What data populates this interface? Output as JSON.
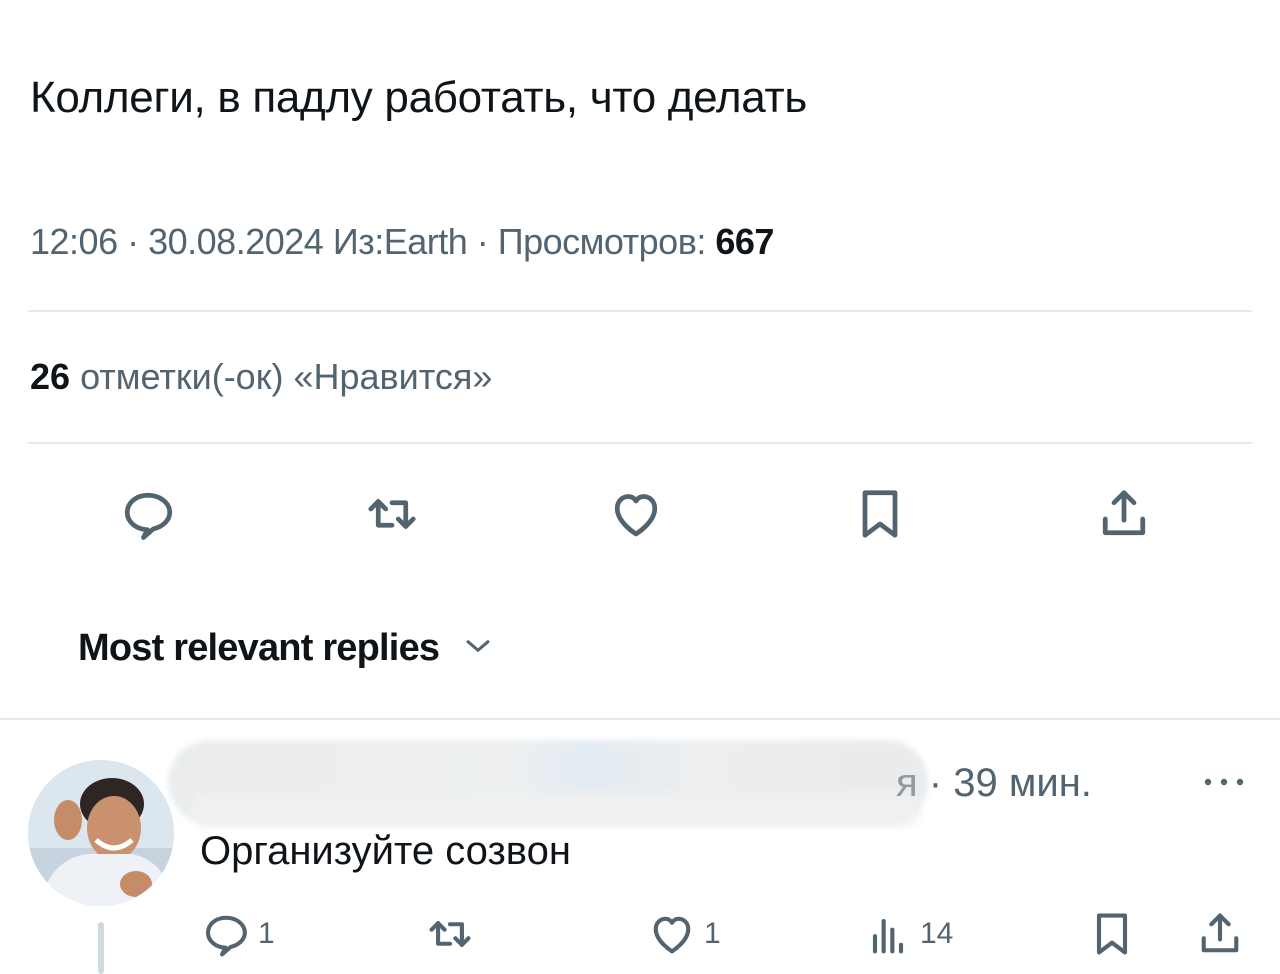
{
  "tweet": {
    "text": "Коллеги, в падлу работать, что делать",
    "time": "12:06",
    "date": "30.08.2024",
    "location": "Из:Earth",
    "views_label": "Просмотров:",
    "views_count": "667",
    "likes_count": "26",
    "likes_label": "отметки(-ок) «Нравится»"
  },
  "actions": [
    {
      "name": "reply",
      "icon": "reply-icon"
    },
    {
      "name": "retweet",
      "icon": "retweet-icon"
    },
    {
      "name": "like",
      "icon": "heart-icon"
    },
    {
      "name": "bookmark",
      "icon": "bookmark-icon"
    },
    {
      "name": "share",
      "icon": "share-icon"
    }
  ],
  "replies_section": {
    "sort_label": "Most relevant replies"
  },
  "reply": {
    "name_suffix": "я",
    "separator": "·",
    "time": "39 мин.",
    "text": "Организуйте созвон",
    "reply_count": "1",
    "like_count": "1",
    "views_count": "14"
  },
  "colors": {
    "text": "#0f1419",
    "secondary": "#536471",
    "divider": "#e6e9ec"
  }
}
